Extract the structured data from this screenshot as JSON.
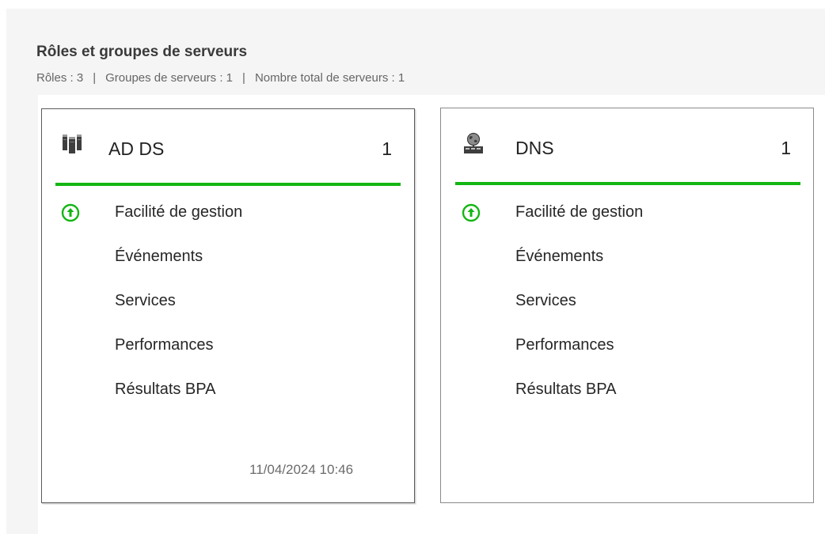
{
  "section": {
    "title": "Rôles et groupes de serveurs",
    "summary": {
      "roles": "Rôles : 3",
      "groups": "Groupes de serveurs : 1",
      "servers": "Nombre total de serveurs : 1",
      "separator": "|"
    }
  },
  "cards": [
    {
      "title": "AD DS",
      "count": "1",
      "icon": "ad-ds-servers-icon",
      "status_icon": "up-arrow-circle-icon",
      "items": [
        "Facilité de gestion",
        "Événements",
        "Services",
        "Performances",
        "Résultats BPA"
      ],
      "timestamp": "11/04/2024 10:46",
      "selected": true
    },
    {
      "title": "DNS",
      "count": "1",
      "icon": "dns-globe-server-icon",
      "status_icon": "up-arrow-circle-icon",
      "items": [
        "Facilité de gestion",
        "Événements",
        "Services",
        "Performances",
        "Résultats BPA"
      ],
      "timestamp": "",
      "selected": false
    }
  ],
  "colors": {
    "accent_green": "#13b613",
    "panel_background": "#f5f5f5",
    "selected_border": "#5a5a5a",
    "card_border": "#8a8a8a",
    "title_text": "#3a3a3a",
    "summary_text": "#666666"
  }
}
